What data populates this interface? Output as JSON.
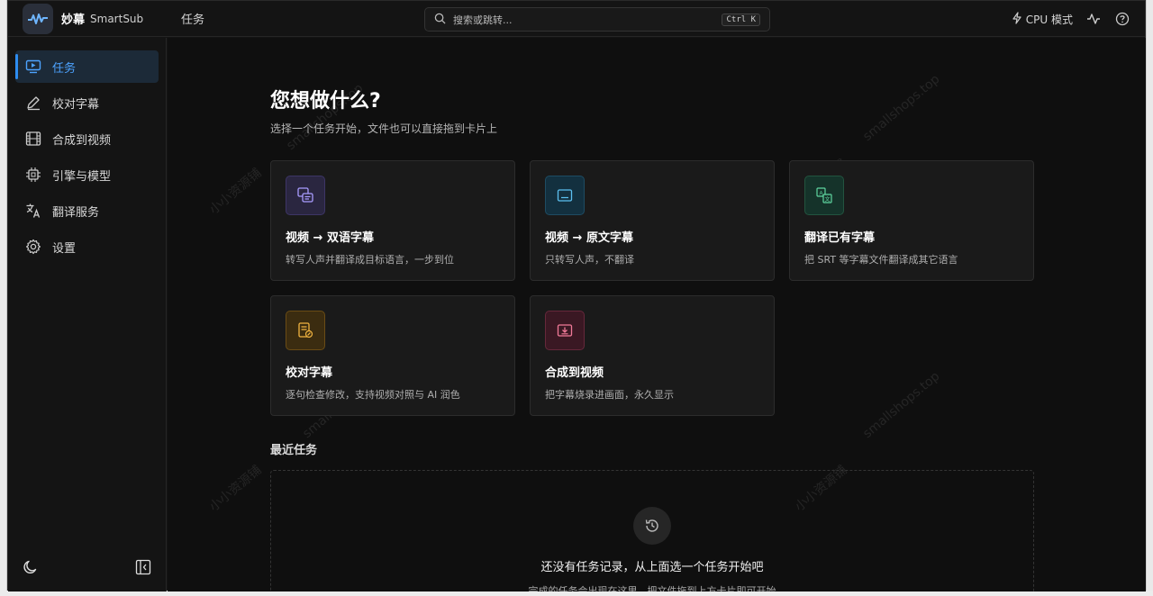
{
  "app": {
    "name": "妙幕",
    "subtitle": "SmartSub"
  },
  "topbar": {
    "tab": "任务",
    "search": {
      "placeholder": "搜索或跳转...",
      "shortcut": "Ctrl K"
    },
    "mode": "CPU 模式"
  },
  "sidebar": {
    "items": [
      {
        "label": "任务",
        "icon": "monitor-icon",
        "active": true
      },
      {
        "label": "校对字幕",
        "icon": "pen-icon"
      },
      {
        "label": "合成到视频",
        "icon": "film-icon"
      },
      {
        "label": "引擎与模型",
        "icon": "chip-icon"
      },
      {
        "label": "翻译服务",
        "icon": "translate-icon"
      },
      {
        "label": "设置",
        "icon": "gear-icon"
      }
    ]
  },
  "main": {
    "title": "您想做什么?",
    "subtitle": "选择一个任务开始，文件也可以直接拖到卡片上",
    "cards": [
      {
        "title": "视频 → 双语字幕",
        "desc": "转写人声并翻译成目标语言，一步到位",
        "icon": "bilingual-icon",
        "color": "#7c6cf0"
      },
      {
        "title": "视频 → 原文字幕",
        "desc": "只转写人声，不翻译",
        "icon": "subtitle-icon",
        "color": "#3aa0e8"
      },
      {
        "title": "翻译已有字幕",
        "desc": "把 SRT 等字幕文件翻译成其它语言",
        "icon": "translate-icon",
        "color": "#3fc28a"
      },
      {
        "title": "校对字幕",
        "desc": "逐句检查修改，支持视频对照与 AI 润色",
        "icon": "edit-doc-icon",
        "color": "#e0a030"
      },
      {
        "title": "合成到视频",
        "desc": "把字幕烧录进画面，永久显示",
        "icon": "burn-icon",
        "color": "#e05a7a"
      }
    ],
    "recent_title": "最近任务",
    "empty": {
      "title": "还没有任务记录，从上面选一个任务开始吧",
      "desc": "完成的任务会出现在这里，把文件拖到上方卡片即可开始"
    }
  },
  "watermarks": [
    "smallshops.top",
    "小小资源铺"
  ]
}
